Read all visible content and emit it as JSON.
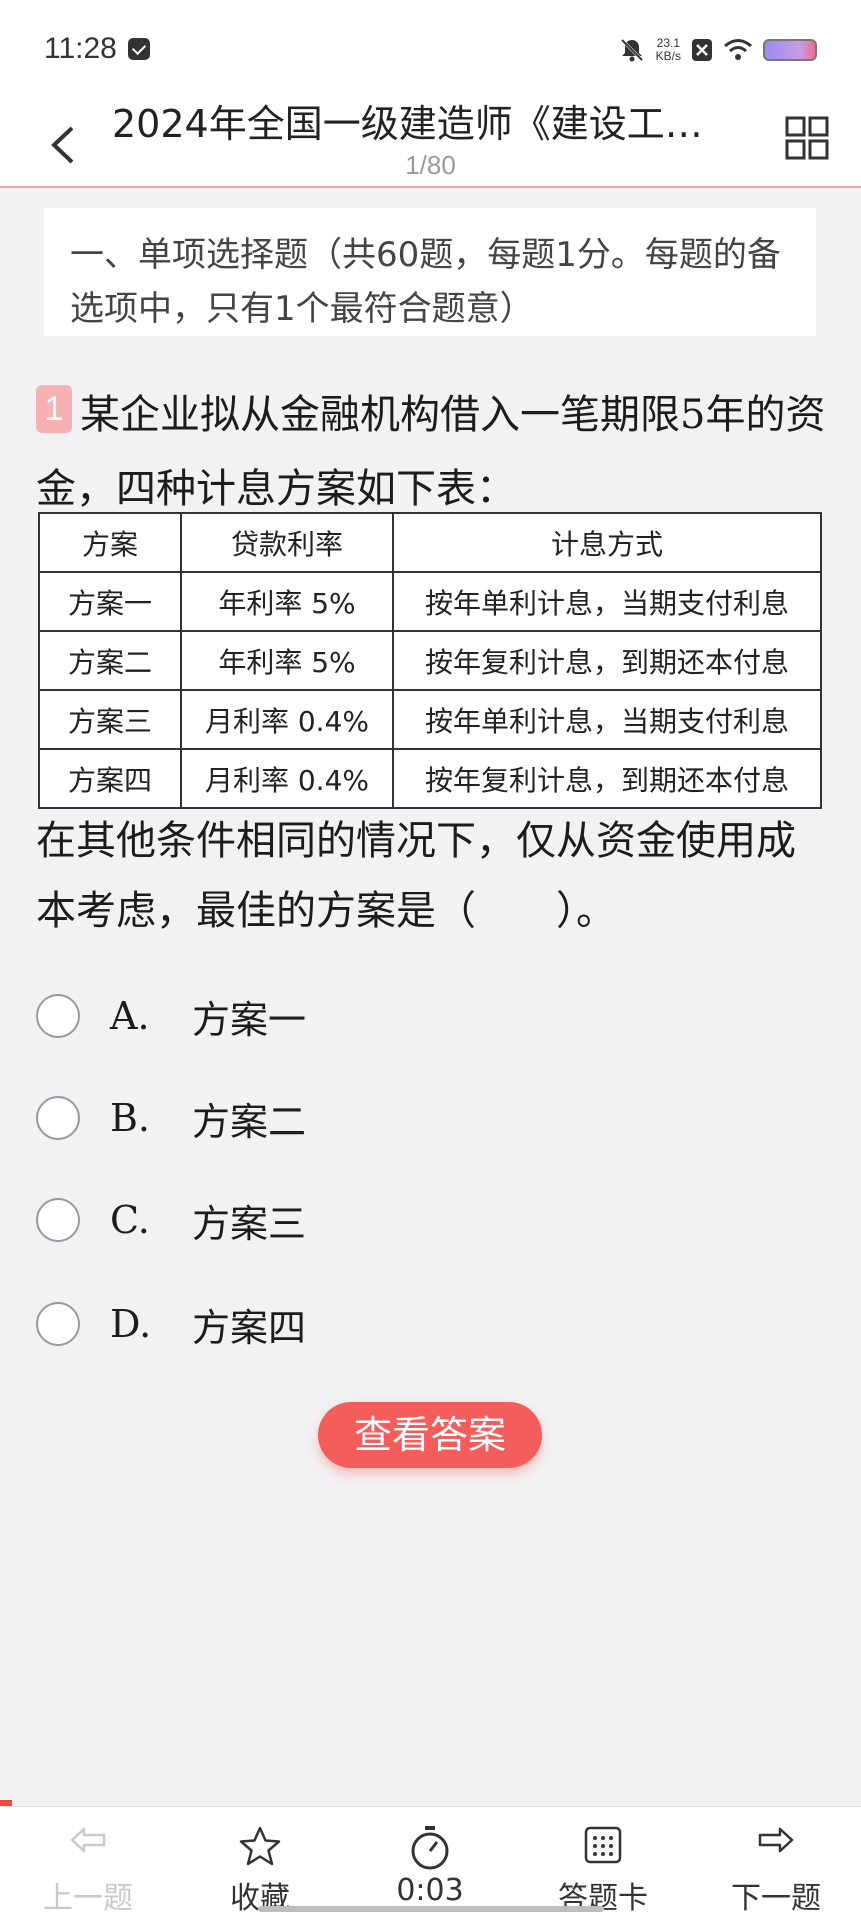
{
  "status_bar": {
    "time": "11:28",
    "speed_value": "23.1",
    "speed_unit": "KB/s"
  },
  "header": {
    "title": "2024年全国一级建造师《建设工…",
    "progress": "1/80"
  },
  "section": {
    "text": "一、单项选择题（共60题，每题1分。每题的备选项中，只有1个最符合题意）"
  },
  "question": {
    "number": "1",
    "stem": "某企业拟从金融机构借入一笔期限5年的资金，四种计息方案如下表：",
    "table": {
      "headers": [
        "方案",
        "贷款利率",
        "计息方式"
      ],
      "rows": [
        [
          "方案一",
          "年利率 5%",
          "按年单利计息，当期支付利息"
        ],
        [
          "方案二",
          "年利率 5%",
          "按年复利计息，到期还本付息"
        ],
        [
          "方案三",
          "月利率 0.4%",
          "按年单利计息，当期支付利息"
        ],
        [
          "方案四",
          "月利率 0.4%",
          "按年复利计息，到期还本付息"
        ]
      ]
    },
    "stem_end": "在其他条件相同的情况下，仅从资金使用成本考虑，最佳的方案是（　　）。"
  },
  "options": [
    {
      "letter": "A.",
      "text": "方案一"
    },
    {
      "letter": "B.",
      "text": "方案二"
    },
    {
      "letter": "C.",
      "text": "方案三"
    },
    {
      "letter": "D.",
      "text": "方案四"
    }
  ],
  "answer_button": "查看答案",
  "bottom_nav": {
    "prev": "上一题",
    "favorite": "收藏",
    "timer": "0:03",
    "answer_card": "答题卡",
    "next": "下一题"
  },
  "colors": {
    "accent": "#f55d5d",
    "header_border": "#f0a2a8",
    "question_badge": "#f7b1b3"
  }
}
